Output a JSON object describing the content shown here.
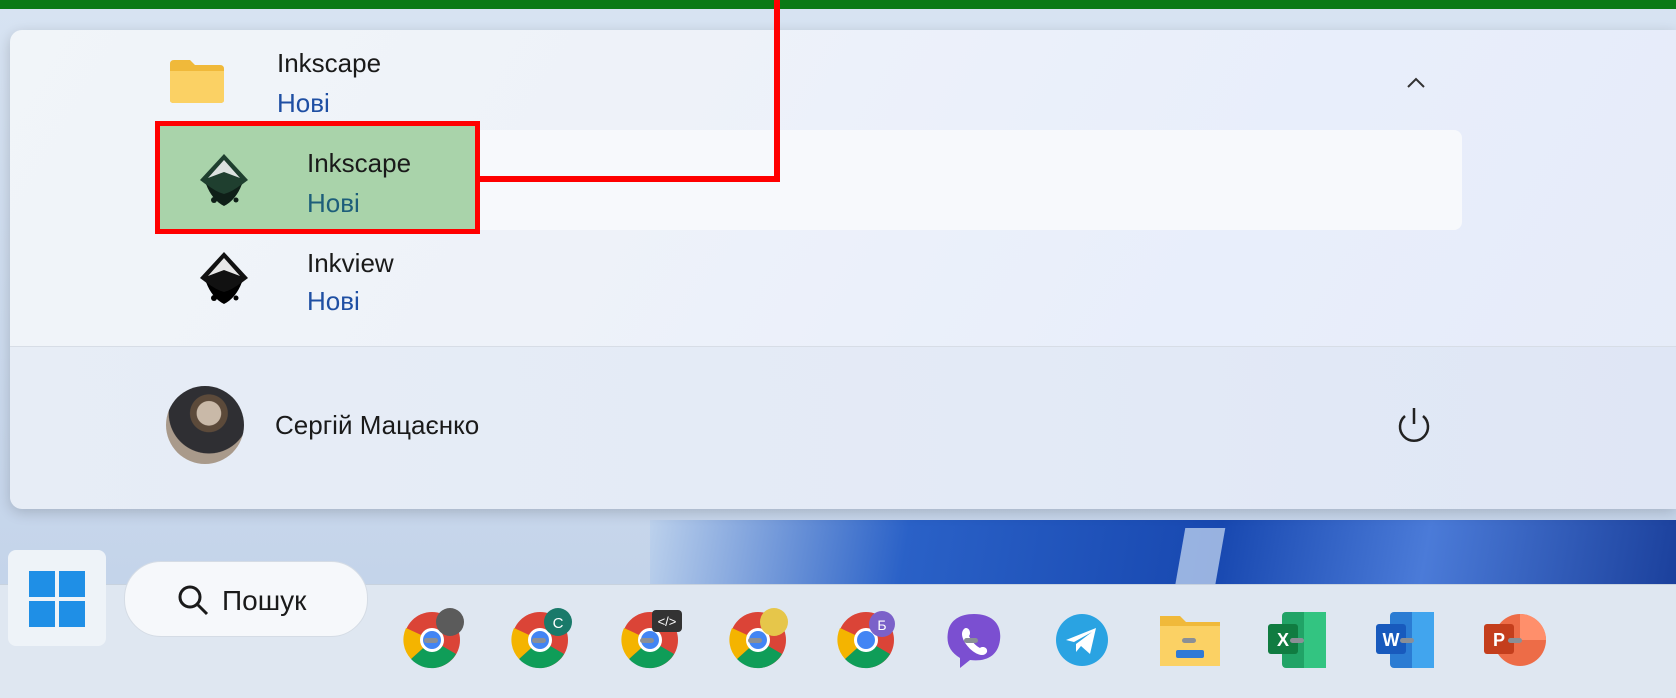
{
  "start_menu": {
    "folder": {
      "title": "Inkscape",
      "badge": "Нові"
    },
    "apps": [
      {
        "title": "Inkscape",
        "badge": "Нові"
      },
      {
        "title": "Inkview",
        "badge": "Нові"
      }
    ],
    "user": {
      "name": "Сергій Мацаєнко"
    }
  },
  "taskbar": {
    "search_label": "Пошук",
    "chrome_badges": [
      "C",
      "</>",
      "Б"
    ]
  },
  "colors": {
    "highlight_border": "#ff0000",
    "highlight_fill": "#a9d3aa",
    "top_bar": "#0b7a16",
    "badge_text": "#1f4fa3"
  }
}
